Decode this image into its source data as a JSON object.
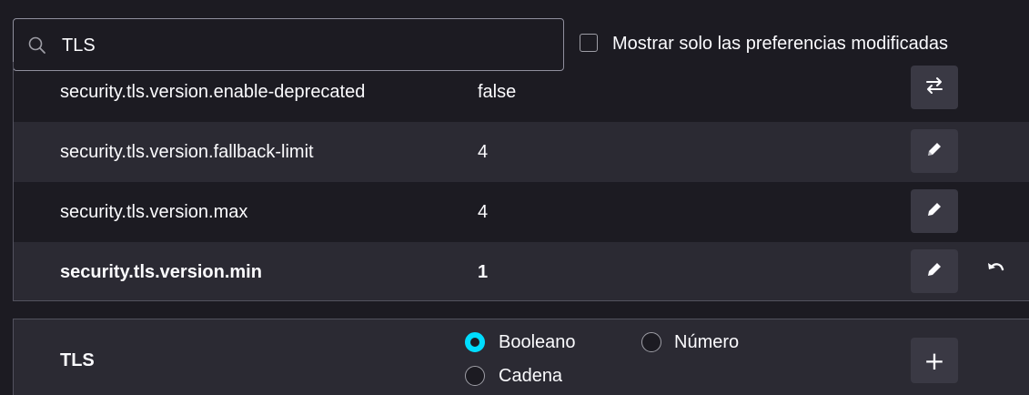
{
  "search": {
    "value": "TLS",
    "icon": "search-icon"
  },
  "filter": {
    "checked": false,
    "label": "Mostrar solo las preferencias modificadas"
  },
  "preferences": [
    {
      "name": "security.tls.version.enable-deprecated",
      "value": "false",
      "action": "toggle-icon",
      "modified": false
    },
    {
      "name": "security.tls.version.fallback-limit",
      "value": "4",
      "action": "edit-icon",
      "modified": false
    },
    {
      "name": "security.tls.version.max",
      "value": "4",
      "action": "edit-icon",
      "modified": false
    },
    {
      "name": "security.tls.version.min",
      "value": "1",
      "action": "edit-icon",
      "modified": true,
      "reset": "reset-icon"
    }
  ],
  "new_pref": {
    "name": "TLS",
    "types": [
      {
        "label": "Booleano",
        "selected": true
      },
      {
        "label": "Número",
        "selected": false
      },
      {
        "label": "Cadena",
        "selected": false
      }
    ],
    "add_label": "+"
  },
  "colors": {
    "background": "#1c1b22",
    "row_alt": "#2b2a33",
    "button": "#3a3944",
    "accent": "#00ddff",
    "text": "#fbfbfe"
  }
}
